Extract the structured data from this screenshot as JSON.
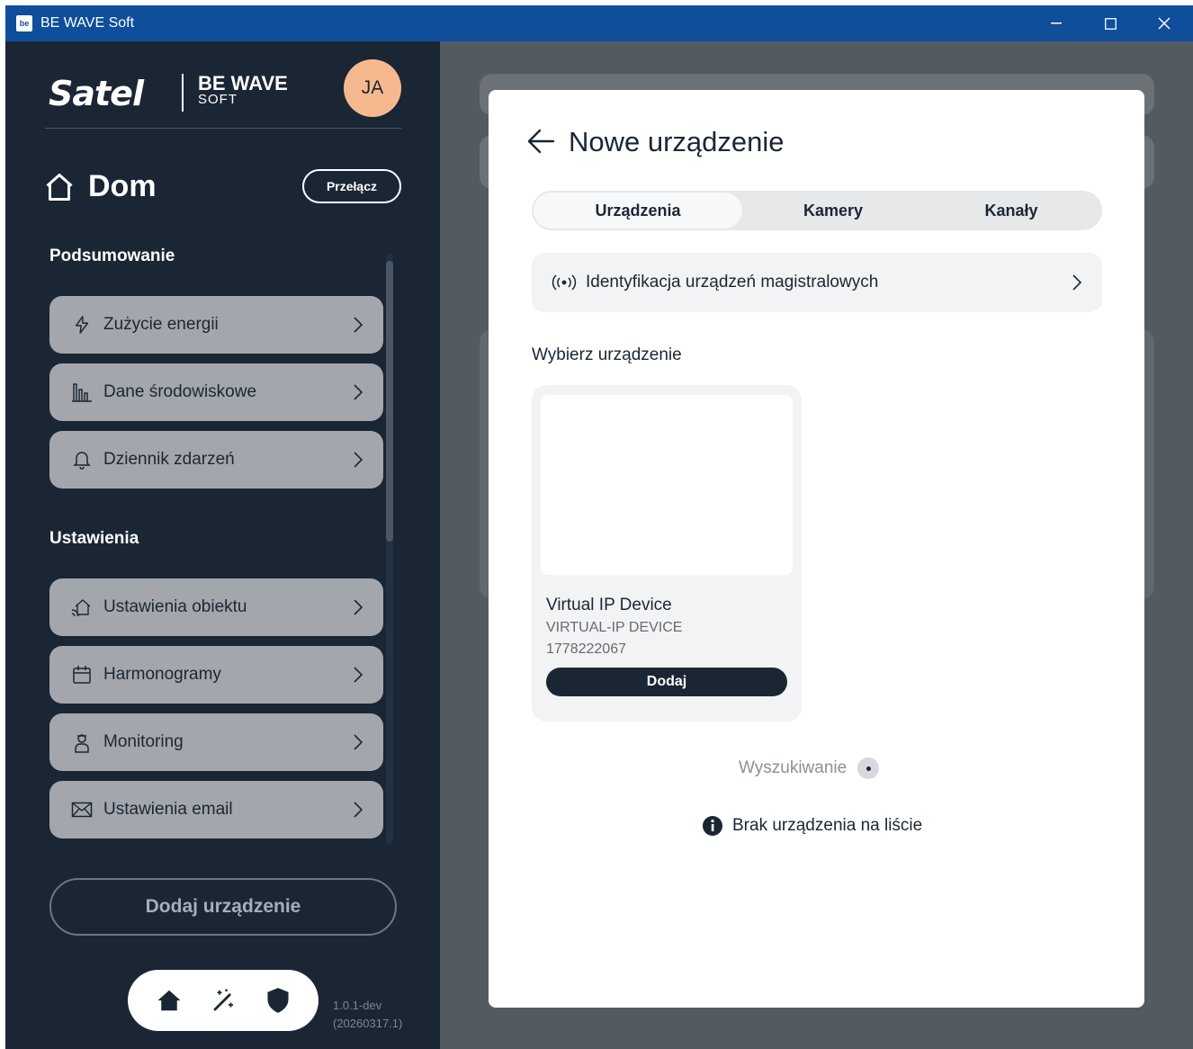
{
  "window": {
    "title": "BE WAVE Soft",
    "logo_text": "be"
  },
  "sidebar": {
    "brand": "Satel",
    "product_name": "BE WAVE",
    "product_sub": "SOFT",
    "avatar_initials": "JA",
    "home_title": "Dom",
    "switch_label": "Przełącz",
    "summary_label": "Podsumowanie",
    "summary_items": [
      {
        "label": "Zużycie energii",
        "icon": "lightning-icon"
      },
      {
        "label": "Dane środowiskowe",
        "icon": "bar-chart-icon"
      },
      {
        "label": "Dziennik zdarzeń",
        "icon": "bell-icon"
      }
    ],
    "settings_label": "Ustawienia",
    "settings_items": [
      {
        "label": "Ustawienia obiektu",
        "icon": "home-wireless-icon"
      },
      {
        "label": "Harmonogramy",
        "icon": "calendar-icon"
      },
      {
        "label": "Monitoring",
        "icon": "guard-icon"
      },
      {
        "label": "Ustawienia email",
        "icon": "envelope-icon"
      }
    ],
    "add_device_label": "Dodaj urządzenie",
    "version_line1": "1.0.1-dev",
    "version_line2": "(20260317.1)"
  },
  "dialog": {
    "title": "Nowe urządzenie",
    "tabs": [
      {
        "label": "Urządzenia",
        "active": true
      },
      {
        "label": "Kamery",
        "active": false
      },
      {
        "label": "Kanały",
        "active": false
      }
    ],
    "identify_label": "Identyfikacja urządzeń magistralowych",
    "choose_label": "Wybierz urządzenie",
    "device": {
      "name": "Virtual IP Device",
      "type": "VIRTUAL-IP DEVICE",
      "serial": "1778222067",
      "add_label": "Dodaj"
    },
    "searching_label": "Wyszukiwanie",
    "missing_label": "Brak urządzenia na liście"
  },
  "colors": {
    "titlebar": "#0e4e9b",
    "sidebar_bg": "#1b2635",
    "menu_item_bg": "#a3a7ad",
    "avatar_bg": "#f6b98f"
  }
}
